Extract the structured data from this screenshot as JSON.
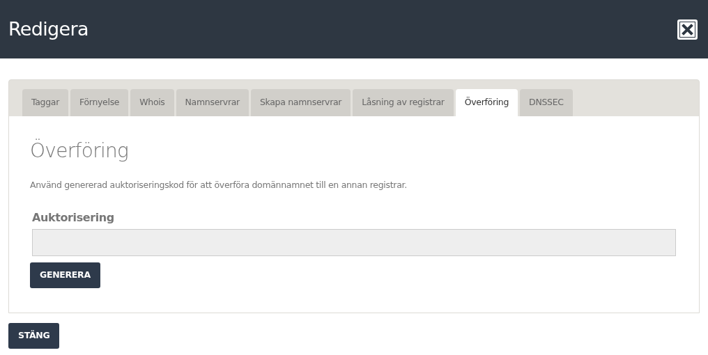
{
  "window": {
    "title": "Redigera"
  },
  "tabs": [
    {
      "label": "Taggar",
      "selected": false
    },
    {
      "label": "Förnyelse",
      "selected": false
    },
    {
      "label": "Whois",
      "selected": false
    },
    {
      "label": "Namnservrar",
      "selected": false
    },
    {
      "label": "Skapa namnservrar",
      "selected": false
    },
    {
      "label": "Låsning av registrar",
      "selected": false
    },
    {
      "label": "Överföring",
      "selected": true
    },
    {
      "label": "DNSSEC",
      "selected": false
    }
  ],
  "section": {
    "heading": "Överföring",
    "description": "Använd genererad auktoriseringskod för att överföra domännamnet till en annan registrar.",
    "field": {
      "label": "Auktorisering",
      "disabled": true
    },
    "button": "GENERERA"
  },
  "footer": {
    "button": "STÄNG"
  }
}
